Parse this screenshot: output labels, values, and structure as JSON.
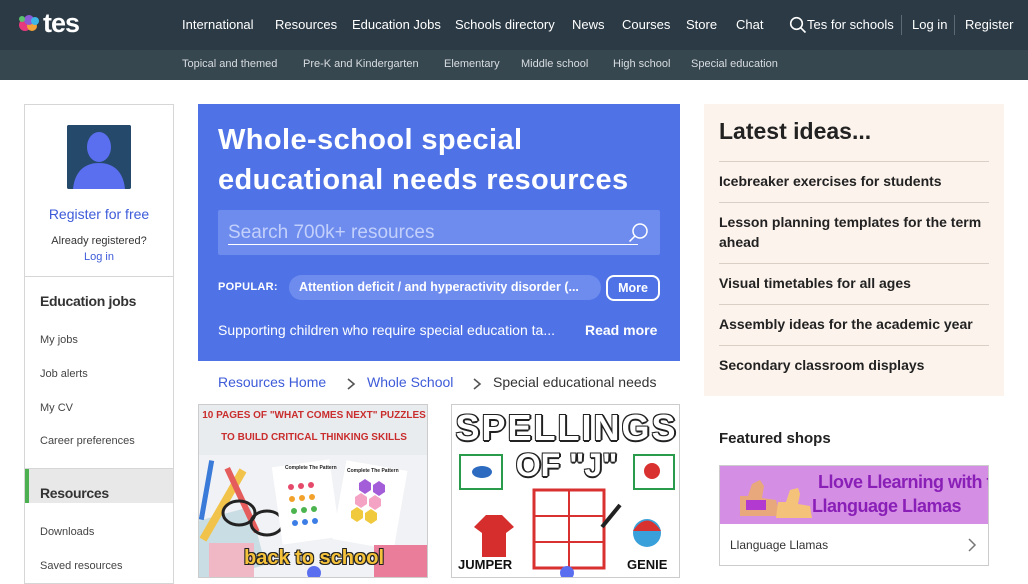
{
  "header": {
    "logo_text": "tes",
    "nav": [
      "International",
      "Resources",
      "Education Jobs",
      "Schools directory",
      "News",
      "Courses",
      "Store",
      "Chat"
    ],
    "tes_for_schools": "Tes for schools",
    "login": "Log in",
    "register": "Register"
  },
  "subnav": [
    "Topical and themed",
    "Pre-K and Kindergarten",
    "Elementary",
    "Middle school",
    "High school",
    "Special education"
  ],
  "sidebar": {
    "register_free": "Register for free",
    "already": "Already registered?",
    "login": "Log in",
    "jobs_heading": "Education jobs",
    "jobs_items": [
      "My jobs",
      "Job alerts",
      "My CV",
      "Career preferences"
    ],
    "resources_heading": "Resources",
    "resources_items": [
      "Downloads",
      "Saved resources"
    ]
  },
  "hero": {
    "title": "Whole-school special educational needs resources",
    "search_placeholder": "Search 700k+ resources",
    "popular_label": "POPULAR:",
    "popular_chip": "Attention deficit / and hyperactivity disorder (...",
    "more": "More",
    "description": "Supporting children who require special education ta...",
    "read_more": "Read more"
  },
  "breadcrumb": [
    "Resources Home",
    "Whole School",
    "Special educational needs"
  ],
  "cards": [
    {
      "caption_top": "10 PAGES OF \"WHAT COMES NEXT\" PUZZLES",
      "caption_top2": "TO BUILD CRITICAL THINKING SKILLS",
      "left_tag": "Complete The Pattern",
      "right_tag": "Complete The Pattern",
      "caption_bottom": "back to school"
    },
    {
      "title_line1": "SPELLINGS",
      "title_line2": "OF \"J\"",
      "word_left": "JUMPER",
      "word_right": "GENIE"
    }
  ],
  "ideas": {
    "title": "Latest ideas...",
    "items": [
      "Icebreaker exercises for students",
      "Lesson planning templates for the term ahead",
      "Visual timetables for all ages",
      "Assembly ideas for the academic year",
      "Secondary classroom displays"
    ]
  },
  "featured": {
    "title": "Featured shops",
    "shop_banner_line1": "Llove Llearning with the",
    "shop_banner_line2": "Llanguage Llamas",
    "shop_name": "Llanguage Llamas"
  }
}
